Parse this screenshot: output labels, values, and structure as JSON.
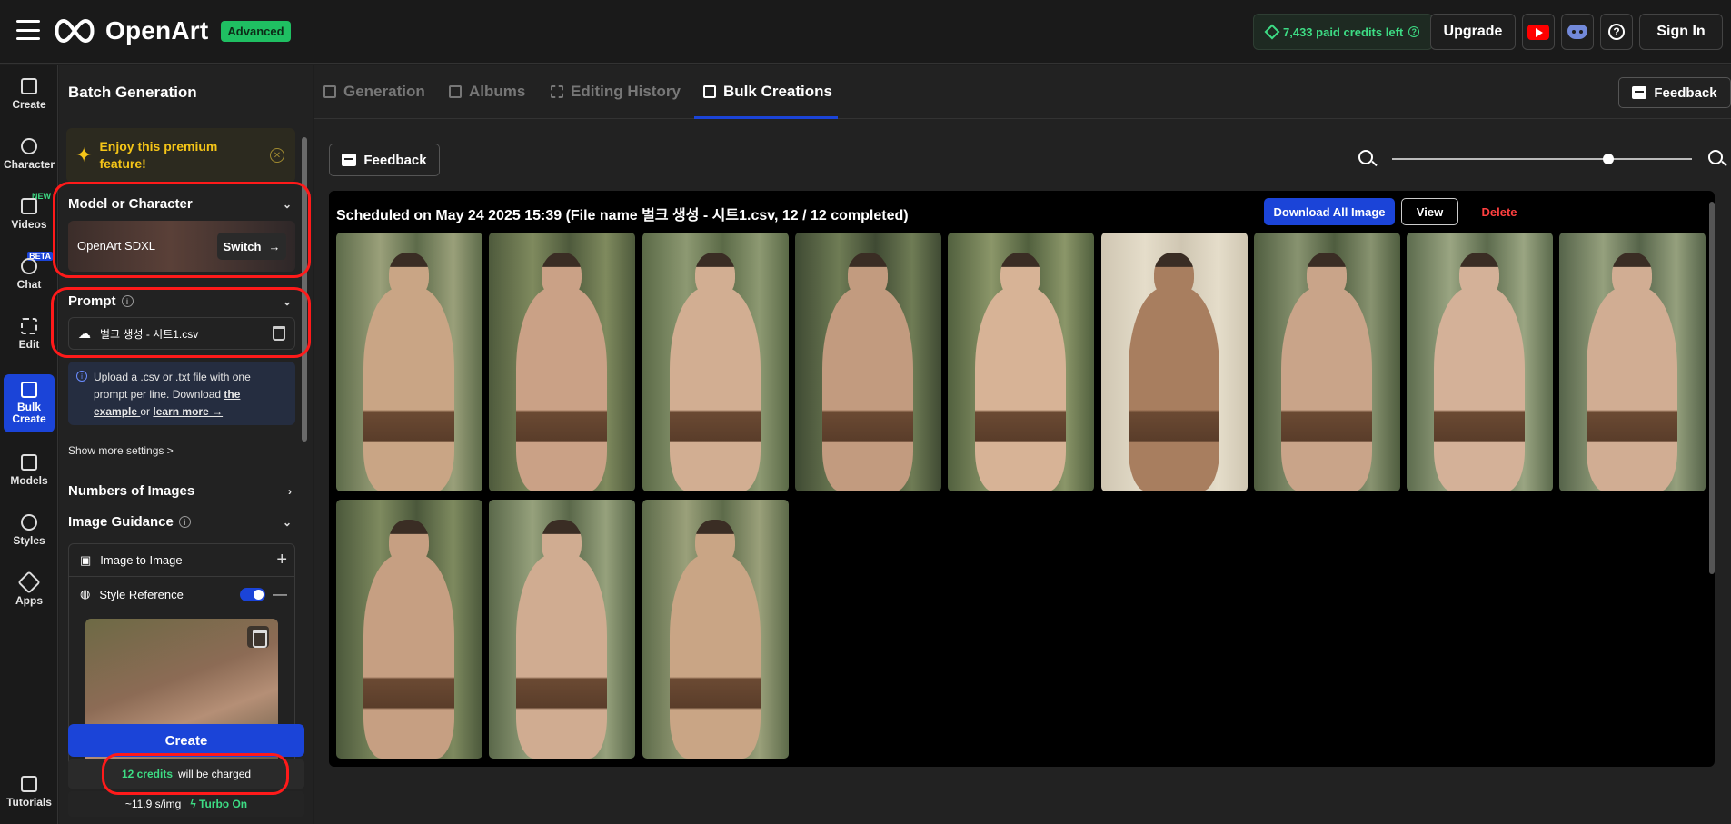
{
  "app": {
    "name": "OpenArt",
    "plan_badge": "Advanced",
    "credits_text": "7,433 paid credits left",
    "upgrade_label": "Upgrade",
    "signin_label": "Sign In"
  },
  "nav": {
    "items": [
      {
        "label": "Create",
        "icon": "create-icon"
      },
      {
        "label": "Character",
        "icon": "character-icon"
      },
      {
        "label": "Videos",
        "icon": "videos-icon",
        "tag": "NEW"
      },
      {
        "label": "Chat",
        "icon": "chat-icon",
        "tag": "BETA"
      },
      {
        "label": "Edit",
        "icon": "edit-icon"
      },
      {
        "label": "Bulk Create",
        "icon": "bulk-create-icon",
        "active": true
      },
      {
        "label": "Models",
        "icon": "models-icon"
      },
      {
        "label": "Styles",
        "icon": "styles-icon"
      },
      {
        "label": "Apps",
        "icon": "apps-icon"
      },
      {
        "label": "Tutorials",
        "icon": "tutorials-icon"
      }
    ]
  },
  "panel": {
    "title": "Batch Generation",
    "premium_text": "Enjoy this premium feature!",
    "model_section": "Model or Character",
    "model_name": "OpenArt SDXL",
    "switch_label": "Switch",
    "prompt_section": "Prompt",
    "file_name": "벌크 생성 - 시트1.csv",
    "upload_note_1": "Upload a .csv or .txt file with one prompt per line. Download ",
    "upload_link_example": "the example ",
    "upload_or": "or ",
    "upload_link_learn": "learn more →",
    "show_more": "Show more settings >",
    "numbers_section": "Numbers of Images",
    "guidance_section": "Image Guidance",
    "img2img_label": "Image to Image",
    "style_ref_label": "Style Reference",
    "style_ref_enabled": true,
    "create_label": "Create",
    "charge_credits": "12 credits",
    "charge_suffix": "will be charged",
    "speed_text": "~11.9 s/img",
    "turbo_text": "Turbo On"
  },
  "main": {
    "tabs": [
      {
        "label": "Generation",
        "icon": "generation-icon"
      },
      {
        "label": "Albums",
        "icon": "folder-icon"
      },
      {
        "label": "Editing History",
        "icon": "editing-history-icon"
      },
      {
        "label": "Bulk Creations",
        "icon": "bulk-creations-icon",
        "active": true
      }
    ],
    "feedback_label": "Feedback",
    "zoom_level": 0.72,
    "gallery": {
      "title": "Scheduled on May 24 2025 15:39 (File name 벌크 생성 - 시트1.csv, 12 / 12 completed)",
      "download_all_label": "Download All Image",
      "view_label": "View",
      "delete_label": "Delete",
      "image_count": 12
    }
  },
  "colors": {
    "accent": "#1b44d8",
    "credit_green": "#3ddc84",
    "premium_yellow": "#f5c518",
    "delete_red": "#ff4040",
    "annotation_red": "#ff1a1a"
  }
}
